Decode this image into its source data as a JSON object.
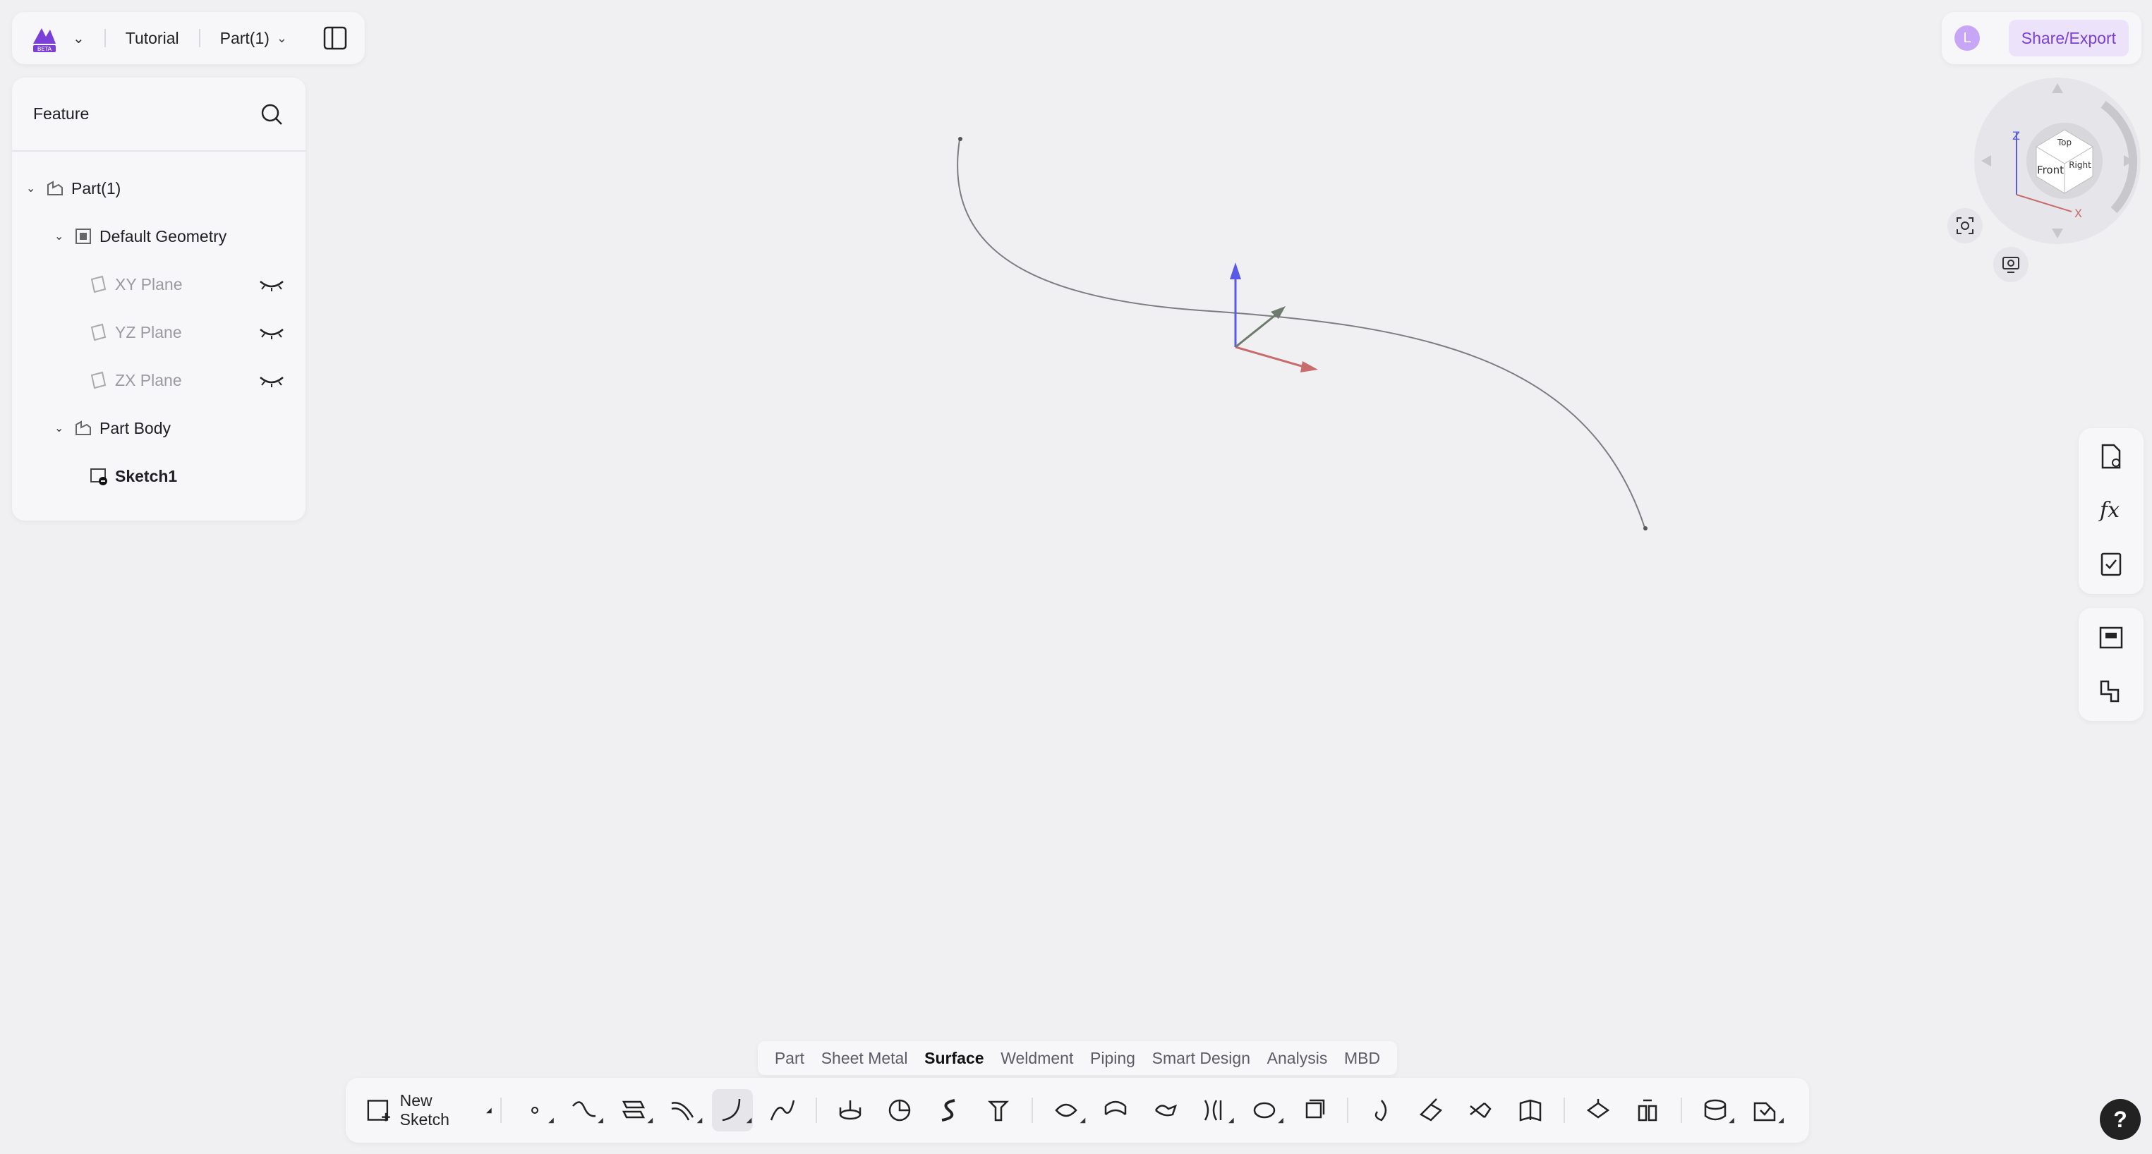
{
  "topbar": {
    "project": "Tutorial",
    "part": "Part(1)",
    "logo_icon": "app-logo-beta-icon",
    "panel_toggle_icon": "split-panel-icon"
  },
  "feature_panel": {
    "title": "Feature",
    "search_icon": "search-icon",
    "tree": [
      {
        "label": "Part(1)",
        "icon": "part-icon"
      },
      {
        "label": "Default Geometry",
        "icon": "geometry-icon"
      },
      {
        "label": "XY Plane",
        "icon": "plane-icon",
        "visibility": "hidden"
      },
      {
        "label": "YZ Plane",
        "icon": "plane-icon",
        "visibility": "hidden"
      },
      {
        "label": "ZX Plane",
        "icon": "plane-icon",
        "visibility": "hidden"
      },
      {
        "label": "Part Body",
        "icon": "body-icon"
      },
      {
        "label": "Sketch1",
        "icon": "sketch-icon"
      }
    ]
  },
  "share": {
    "avatar_letter": "L",
    "button_label": "Share/Export"
  },
  "viewcube": {
    "faces": {
      "top": "Top",
      "front": "Front",
      "right": "Right"
    },
    "axes": {
      "z": "Z",
      "x": "X"
    }
  },
  "tabs": [
    {
      "label": "Part",
      "active": false
    },
    {
      "label": "Sheet Metal",
      "active": false
    },
    {
      "label": "Surface",
      "active": true
    },
    {
      "label": "Weldment",
      "active": false
    },
    {
      "label": "Piping",
      "active": false
    },
    {
      "label": "Smart Design",
      "active": false
    },
    {
      "label": "Analysis",
      "active": false
    },
    {
      "label": "MBD",
      "active": false
    }
  ],
  "toolbar": {
    "new_sketch_label": "New Sketch"
  },
  "help_label": "?",
  "colors": {
    "accent": "#7a3fd6",
    "axis_z": "#5a5ae6",
    "axis_x": "#c86b6b",
    "axis_y": "#6f7a6f"
  }
}
